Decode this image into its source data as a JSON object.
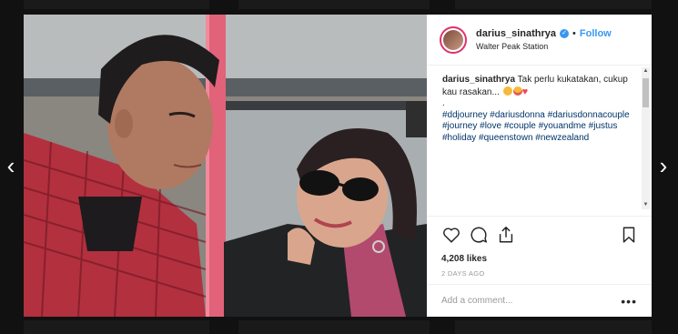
{
  "post": {
    "username": "darius_sinathrya",
    "follow_label": "Follow",
    "separator": "•",
    "location": "Walter Peak Station",
    "caption_username": "darius_sinathrya",
    "caption_text": " Tak perlu kukatakan, cukup kau rasakan... ",
    "caption_dot": ".",
    "hashtags": "#ddjourney #dariusdonna #dariusdonnacouple #journey #love #couple #youandme #justus #holiday #queenstown #newzealand",
    "likes": "4,208 likes",
    "time_ago": "2 DAYS AGO",
    "comment_placeholder": "Add a comment...",
    "more_label": "•••"
  },
  "navigation": {
    "prev_label": "‹",
    "next_label": "›"
  },
  "icons": {
    "like": "heart-outline-icon",
    "comment": "comment-bubble-icon",
    "share": "share-upload-icon",
    "save": "bookmark-icon",
    "verified": "verified-badge-icon"
  },
  "colors": {
    "accent": "#3897f0",
    "text": "#262626",
    "muted": "#999999",
    "hashtag": "#003569",
    "heart": "#ed4956"
  }
}
